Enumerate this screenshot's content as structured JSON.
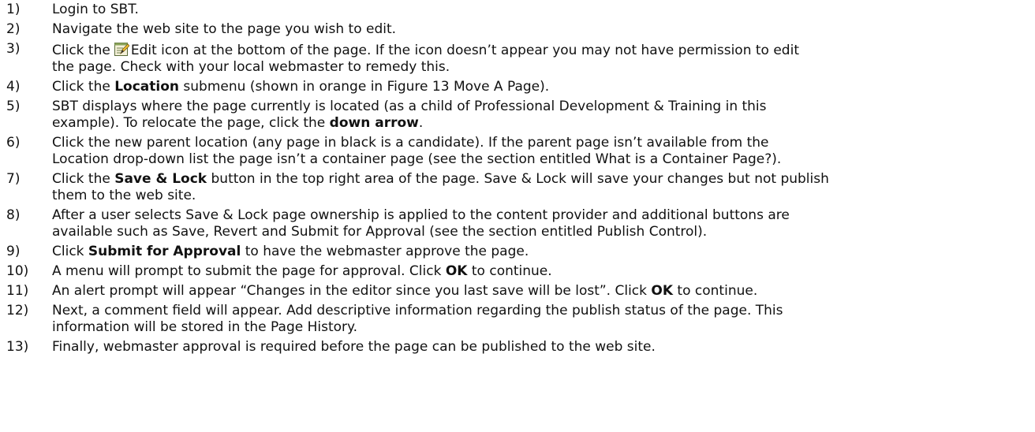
{
  "steps": [
    {
      "num": "1)",
      "text": "Login to SBT."
    },
    {
      "num": "2)",
      "text": "Navigate the web site to the page you wish to edit."
    },
    {
      "num": "3)",
      "pre": "Click the",
      "icon": "edit-icon",
      "post": "Edit icon at the bottom of the page.  If the icon doesn’t appear you may not have permission to edit",
      "line2": "the page.  Check with your local webmaster to remedy this."
    },
    {
      "num": "4)",
      "pre": "Click the ",
      "bold": "Location",
      "post": " submenu (shown in orange in Figure 13 Move A Page)."
    },
    {
      "num": "5)",
      "text": "SBT displays where the page currently is located (as a child of Professional Development & Training in this",
      "line2_pre": "example). To relocate the page, click the ",
      "line2_bold": "down arrow",
      "line2_post": "."
    },
    {
      "num": "6)",
      "text": "Click the new parent location (any page in black is a candidate).  If the parent page isn’t available from the",
      "line2": "Location drop-down list the page isn’t a container page (see the section entitled What is a Container Page?)."
    },
    {
      "num": "7)",
      "pre": "Click the ",
      "bold": "Save & Lock",
      "post": " button in the top right area of the page.  Save & Lock will save your changes but not publish",
      "line2": "them to the web site."
    },
    {
      "num": "8)",
      "text": "After a user selects Save & Lock page ownership is applied to the content provider and additional buttons are",
      "line2": "available such as Save, Revert and Submit for Approval (see the section entitled Publish Control)."
    },
    {
      "num": "9)",
      "pre": "Click ",
      "bold": "Submit for Approval",
      "post": " to have the webmaster approve the page."
    },
    {
      "num": "10)",
      "pre": "A menu will prompt to submit the page for approval.  Click ",
      "bold": "OK",
      "post": " to continue."
    },
    {
      "num": "11)",
      "pre": "An alert prompt will appear “Changes in the editor since you last save will be lost”.  Click ",
      "bold": "OK",
      "post": " to continue."
    },
    {
      "num": "12)",
      "text": "Next, a comment field will appear.  Add descriptive information regarding the publish status of the page.  This",
      "line2": "information will be stored in the Page History."
    },
    {
      "num": "13)",
      "text": "Finally, webmaster approval is required before the page can be published to the web site."
    }
  ]
}
